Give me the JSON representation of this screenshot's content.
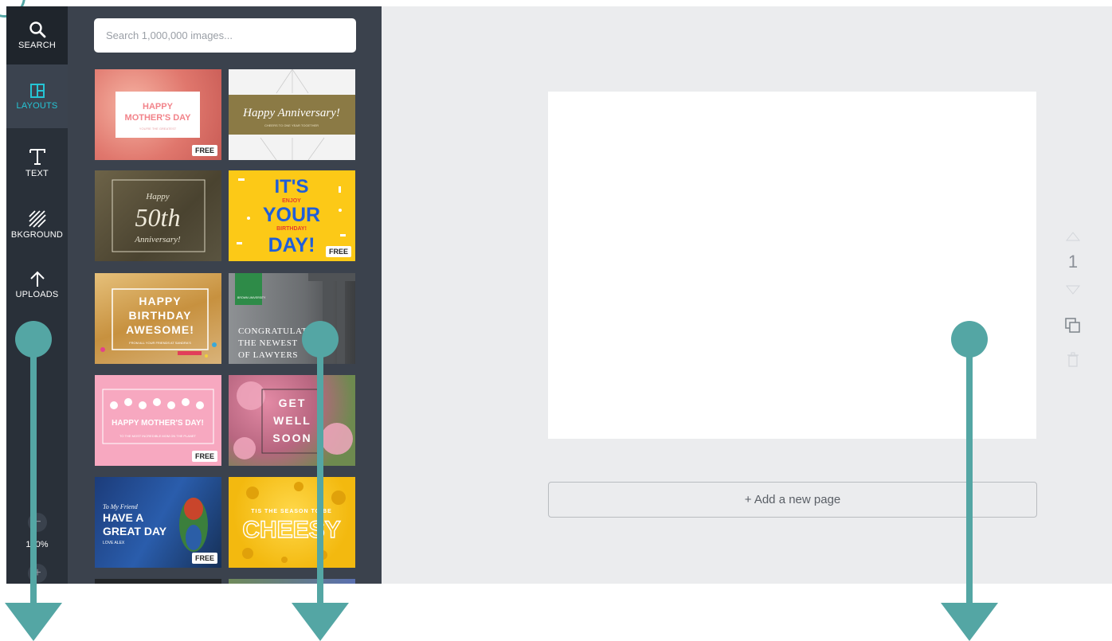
{
  "rail": {
    "items": [
      {
        "label": "SEARCH",
        "icon": "search-icon"
      },
      {
        "label": "LAYOUTS",
        "icon": "layouts-icon"
      },
      {
        "label": "TEXT",
        "icon": "text-icon"
      },
      {
        "label": "BKGROUND",
        "icon": "background-icon"
      },
      {
        "label": "UPLOADS",
        "icon": "upload-icon"
      }
    ],
    "zoom_minus": "−",
    "zoom_level": "100%",
    "zoom_plus": "+"
  },
  "panel": {
    "search_placeholder": "Search 1,000,000 images...",
    "layouts": [
      {
        "line1": "HAPPY",
        "line2": "MOTHER'S DAY",
        "sub": "YOU'RE THE GREATEST",
        "badge": "FREE"
      },
      {
        "line1": "Happy Anniversary!",
        "sub": "CHEERS TO ONE YEAR TOGETHER",
        "badge": ""
      },
      {
        "line1": "Happy",
        "line2": "50th",
        "line3": "Anniversary!",
        "badge": ""
      },
      {
        "line1": "IT'S",
        "line2": "ENJOY",
        "line3": "YOUR",
        "line4": "BIRTHDAY!",
        "line5": "DAY!",
        "badge": "FREE"
      },
      {
        "line1": "HAPPY",
        "line2": "BIRTHDAY",
        "line3": "AWESOME!",
        "sub": "FROM ALL YOUR FRIENDS AT SANDRA'S",
        "badge": ""
      },
      {
        "line1": "CONGRATULATIONS",
        "line2": "THE NEWEST",
        "line3": "OF LAWYERS",
        "sub": "BROWN UNIVERSITY",
        "badge": ""
      },
      {
        "line1": "HAPPY MOTHER'S DAY!",
        "sub": "TO THE MOST INCREDIBLE MOM ON THE PLANET",
        "badge": "FREE"
      },
      {
        "line1": "GET",
        "line2": "WELL",
        "line3": "SOON",
        "badge": ""
      },
      {
        "line1": "To My Friend",
        "line2": "HAVE A",
        "line3": "GREAT DAY",
        "sub": "LOVE ALEX",
        "badge": "FREE"
      },
      {
        "line1": "TIS THE SEASON TO BE",
        "line2": "CHEESY",
        "badge": ""
      }
    ]
  },
  "workspace": {
    "add_page_label": "+ Add a new page",
    "page_number": "1"
  },
  "colors": {
    "accent": "#25c5d5",
    "annotation": "#54a6a4",
    "rail_bg": "#293039",
    "panel_bg": "#3b424d",
    "workspace_bg": "#ebecee"
  }
}
